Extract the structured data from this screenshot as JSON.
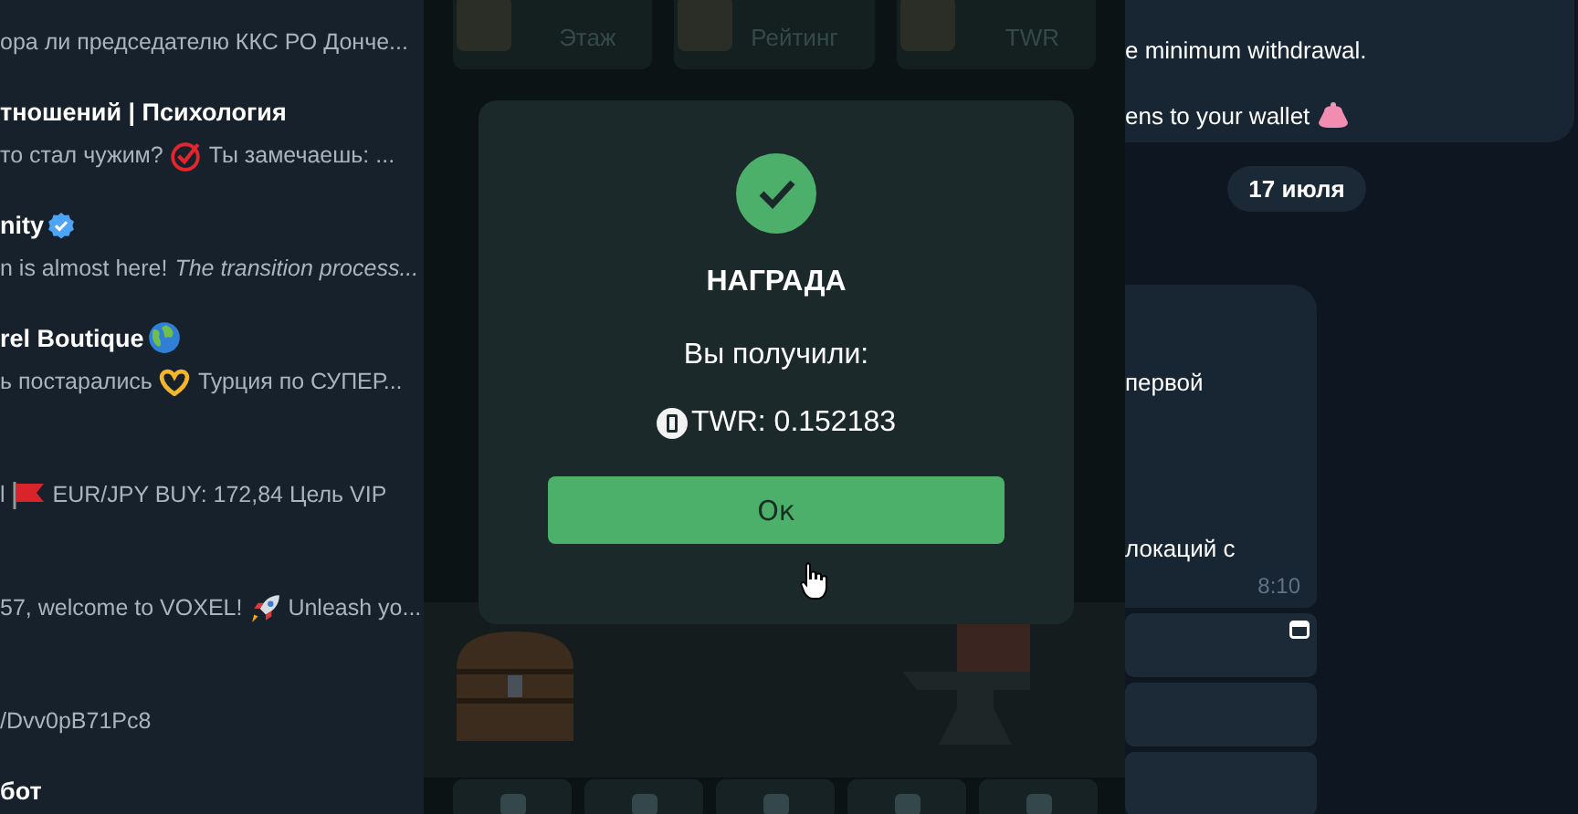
{
  "chat_list": {
    "items": [
      {
        "preview": [
          {
            "kind": "text",
            "text": "ора ли председателю ККС РО Донче..."
          }
        ]
      },
      {
        "title": [
          {
            "kind": "text",
            "text": "тношений | Психология"
          }
        ],
        "preview": [
          {
            "kind": "text",
            "text": "то стал чужим?"
          },
          {
            "kind": "check"
          },
          {
            "kind": "text",
            "text": "Ты замечаешь: ..."
          }
        ]
      },
      {
        "title": [
          {
            "kind": "text",
            "text": "nity"
          },
          {
            "kind": "verified"
          }
        ],
        "preview": [
          {
            "kind": "text",
            "text": "n is almost here!"
          },
          {
            "kind": "text",
            "text": "*The transition process...*"
          }
        ]
      },
      {
        "title": [
          {
            "kind": "text",
            "text": "rel Boutique"
          },
          {
            "kind": "globe"
          }
        ],
        "preview": [
          {
            "kind": "text",
            "text": "ь постарались"
          },
          {
            "kind": "hands"
          },
          {
            "kind": "text",
            "text": "Турция по СУПЕР..."
          }
        ]
      },
      {
        "preview": [
          {
            "kind": "text",
            "text": "l"
          },
          {
            "kind": "flag"
          },
          {
            "kind": "text",
            "text": "EUR/JPY  BUY: 172,84  Цель VIP"
          }
        ]
      },
      {
        "preview": [
          {
            "kind": "text",
            "text": "57, welcome to VOXEL!"
          },
          {
            "kind": "rocket"
          },
          {
            "kind": "text",
            "text": "Unleash yo..."
          }
        ]
      },
      {
        "preview": [
          {
            "kind": "text",
            "text": "/Dvv0pB71Pc8"
          }
        ]
      },
      {
        "title": [
          {
            "kind": "text",
            "text": "бот"
          }
        ]
      }
    ]
  },
  "game": {
    "stats": [
      {
        "label": "Этаж"
      },
      {
        "label": "Рейтинг"
      },
      {
        "label": "TWR"
      }
    ],
    "reward_dialog": {
      "title": "НАГРАДА",
      "subtitle": "Вы получили:",
      "reward": "TWR: 0.152183",
      "button": "Ок"
    }
  },
  "chat": {
    "messages": [
      {
        "kind": "text",
        "lines": [
          [
            {
              "kind": "text",
              "text": "e minimum withdrawal."
            }
          ],
          [
            {
              "kind": "text",
              "text": "ens to your wallet"
            },
            {
              "kind": "purse"
            }
          ]
        ]
      },
      {
        "kind": "date",
        "text": "17 июля"
      },
      {
        "kind": "bot",
        "lines": [
          [
            {
              "kind": "text",
              "text": "первой"
            }
          ],
          [
            {
              "kind": "text",
              "text": "локаций с"
            }
          ]
        ],
        "time": "8:10",
        "keyboard": [
          {
            "kind": "webapp"
          },
          {
            "kind": "plain"
          },
          {
            "kind": "plain"
          }
        ]
      }
    ]
  }
}
